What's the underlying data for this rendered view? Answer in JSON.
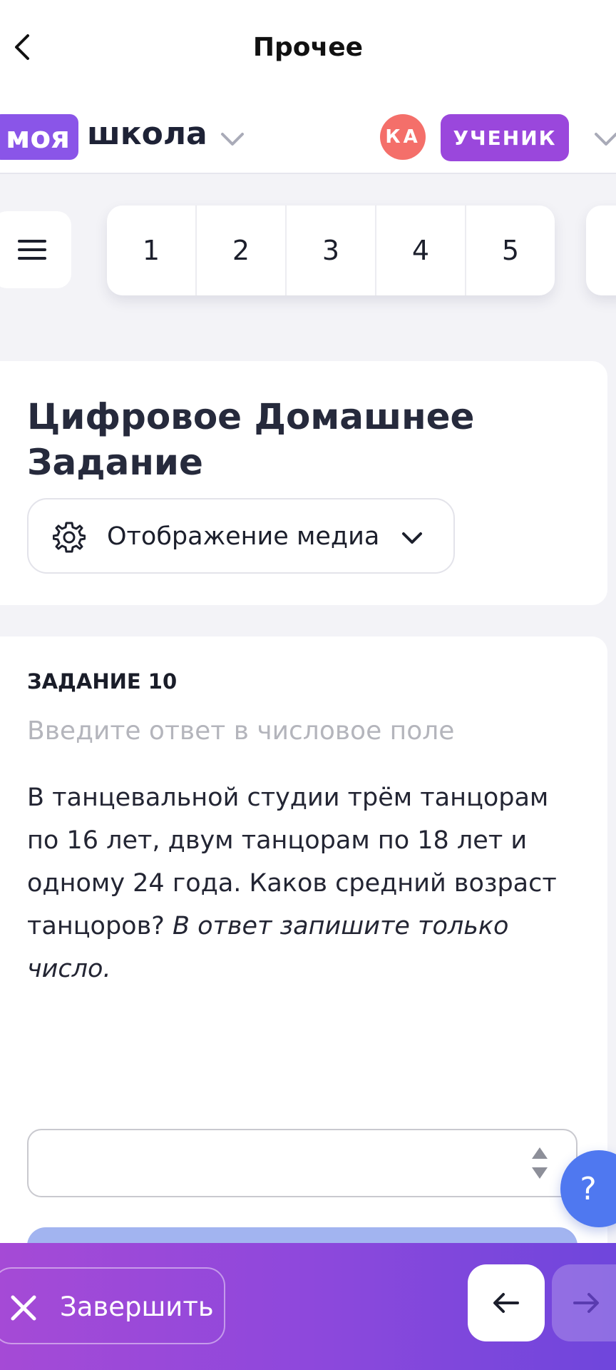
{
  "nav": {
    "title": "Прочее"
  },
  "school": {
    "logo_part1": "моя",
    "logo_part2": "школа",
    "avatar_initials": "КА",
    "role_label": "УЧЕНИК"
  },
  "task_numbers": [
    "1",
    "2",
    "3",
    "4",
    "5"
  ],
  "page": {
    "title": "Цифровое Домашнее Задание",
    "media_dropdown_label": "Отображение медиа"
  },
  "question": {
    "label": "ЗАДАНИЕ 10",
    "hint": "Введите ответ в числовое поле",
    "text": "В танцевальной студии трём танцорам по 16 лет, двум танцорам по 18 лет и одному 24 года. Каков средний возраст танцоров?",
    "instruction": "В ответ запишите только число.",
    "answer_value": ""
  },
  "help": {
    "label": "?"
  },
  "footer": {
    "finish_label": "Завершить"
  },
  "colors": {
    "brand_purple": "#8a55e8",
    "role_purple": "#9a47dc",
    "avatar_red": "#f46f6a",
    "help_blue": "#4f78f0"
  },
  "icons": {
    "back": "chevron-left-icon",
    "menu": "hamburger-icon",
    "media": "gear-icon",
    "finish": "close-icon",
    "prev": "arrow-left-icon",
    "next": "arrow-right-icon"
  }
}
